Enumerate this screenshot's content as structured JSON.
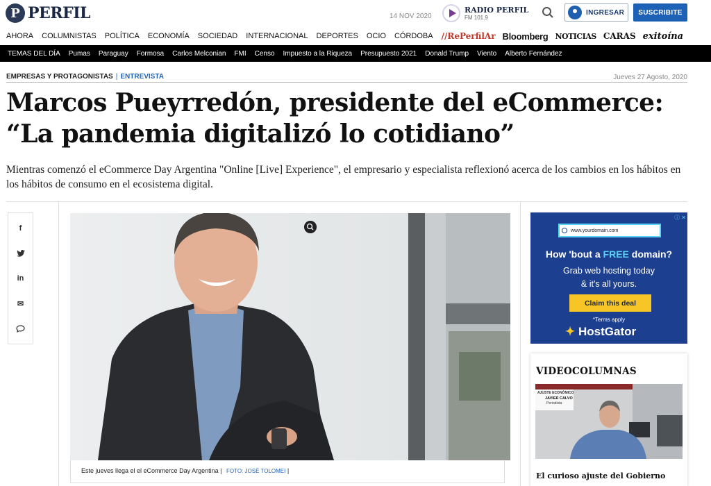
{
  "header": {
    "logo_mark": "P",
    "logo_text": "PERFIL",
    "date": "14 NOV 2020",
    "radio_name": "RADIO PERFIL",
    "radio_freq": "FM 101.9",
    "login_label": "INGRESAR",
    "subscribe_label": "SUSCRIBITE"
  },
  "nav": {
    "items": [
      "AHORA",
      "COLUMNISTAS",
      "POLÍTICA",
      "ECONOMÍA",
      "SOCIEDAD",
      "INTERNACIONAL",
      "DEPORTES",
      "OCIO",
      "CÓRDOBA"
    ],
    "brands": [
      "//RePerfilAr",
      "Bloomberg",
      "NOTICIAS",
      "CARAS",
      "exitoína"
    ]
  },
  "topics": [
    "TEMAS DEL DÍA",
    "Pumas",
    "Paraguay",
    "Formosa",
    "Carlos Melconian",
    "FMI",
    "Censo",
    "Impuesto a la Riqueza",
    "Presupuesto 2021",
    "Donald Trump",
    "Viento",
    "Alberto Fernández"
  ],
  "article": {
    "section": "EMPRESAS Y PROTAGONISTAS",
    "separator": "|",
    "subsection": "ENTREVISTA",
    "date": "Jueves 27 Agosto, 2020",
    "headline_line1": "Marcos Pueyrredón, presidente del eCommerce:",
    "headline_line2": "“La pandemia digitalizó lo cotidiano”",
    "dek": "Mientras comenzó el eCommerce Day Argentina \"Online [Live] Experience\", el empresario y especialista reflexionó acerca de los cambios en los hábitos en los hábitos de consumo en el ecosistema digital.",
    "caption": "Este jueves llega el el eCommerce Day Argentina",
    "caption_sep": "|",
    "photo_credit": "FOTO: JOSÉ TOLOMEI",
    "photo_credit_end": "|"
  },
  "share": [
    "facebook-icon",
    "twitter-icon",
    "linkedin-icon",
    "mail-icon",
    "comment-icon"
  ],
  "share_glyphs": [
    "f",
    "t",
    "in",
    "✉",
    "💬"
  ],
  "ad": {
    "url": "www.yourdomain.com",
    "headline_pre": "How 'bout a ",
    "headline_free": "FREE",
    "headline_post": " domain?",
    "line1": "Grab web hosting today",
    "line2": "& it's all yours.",
    "button": "Claim this deal",
    "terms": "*Terms apply",
    "brand": "HostGator",
    "adchoices": "ⓘ ✕"
  },
  "videocolumnas": {
    "title": "VIDEOCOLUMNAS",
    "thumb_tag": "AJUSTE ECONÓMICO",
    "thumb_name": "JAVIER CALVO",
    "thumb_role": "Periodista",
    "caption": "El curioso ajuste del Gobierno"
  },
  "colors": {
    "brand_navy": "#1a2745",
    "accent_blue": "#1e62b8",
    "topics_bg": "#000000",
    "ad_bg": "#1d3f8f",
    "ad_button": "#f7c525"
  }
}
